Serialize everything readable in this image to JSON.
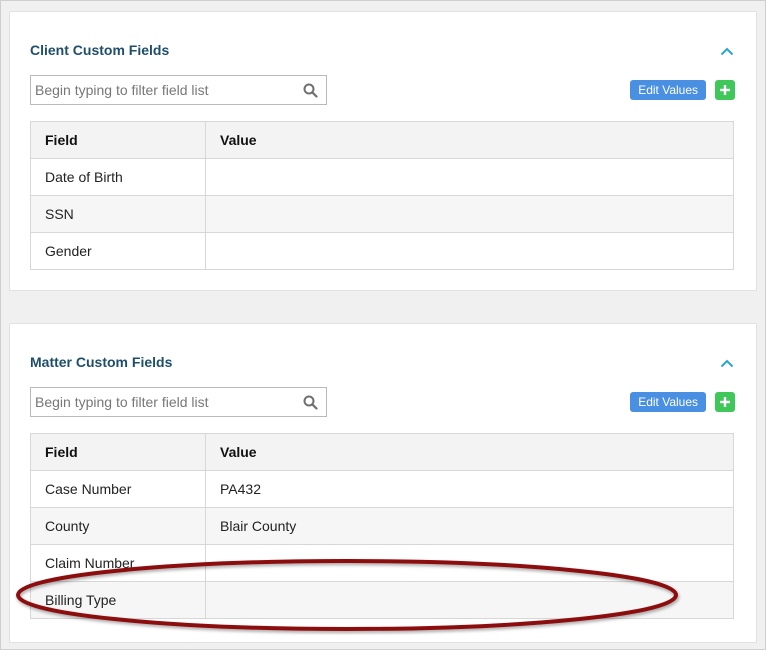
{
  "client_panel": {
    "title": "Client Custom Fields",
    "filter_placeholder": "Begin typing to filter field list",
    "edit_label": "Edit Values",
    "columns": [
      "Field",
      "Value"
    ],
    "rows": [
      {
        "field": "Date of Birth",
        "value": ""
      },
      {
        "field": "SSN",
        "value": ""
      },
      {
        "field": "Gender",
        "value": ""
      }
    ]
  },
  "matter_panel": {
    "title": "Matter Custom Fields",
    "filter_placeholder": "Begin typing to filter field list",
    "edit_label": "Edit Values",
    "columns": [
      "Field",
      "Value"
    ],
    "rows": [
      {
        "field": "Case Number",
        "value": "PA432"
      },
      {
        "field": "County",
        "value": "Blair County"
      },
      {
        "field": "Claim Number",
        "value": ""
      },
      {
        "field": "Billing Type",
        "value": ""
      }
    ]
  },
  "icons": {
    "collapse": "chevron-up-icon",
    "search": "search-icon",
    "add": "plus-icon"
  },
  "colors": {
    "title": "#1e4e6b",
    "edit_button": "#4a90e2",
    "add_button": "#3fc85a",
    "chevron": "#2aa4d8",
    "annotation": "#8b1010"
  }
}
